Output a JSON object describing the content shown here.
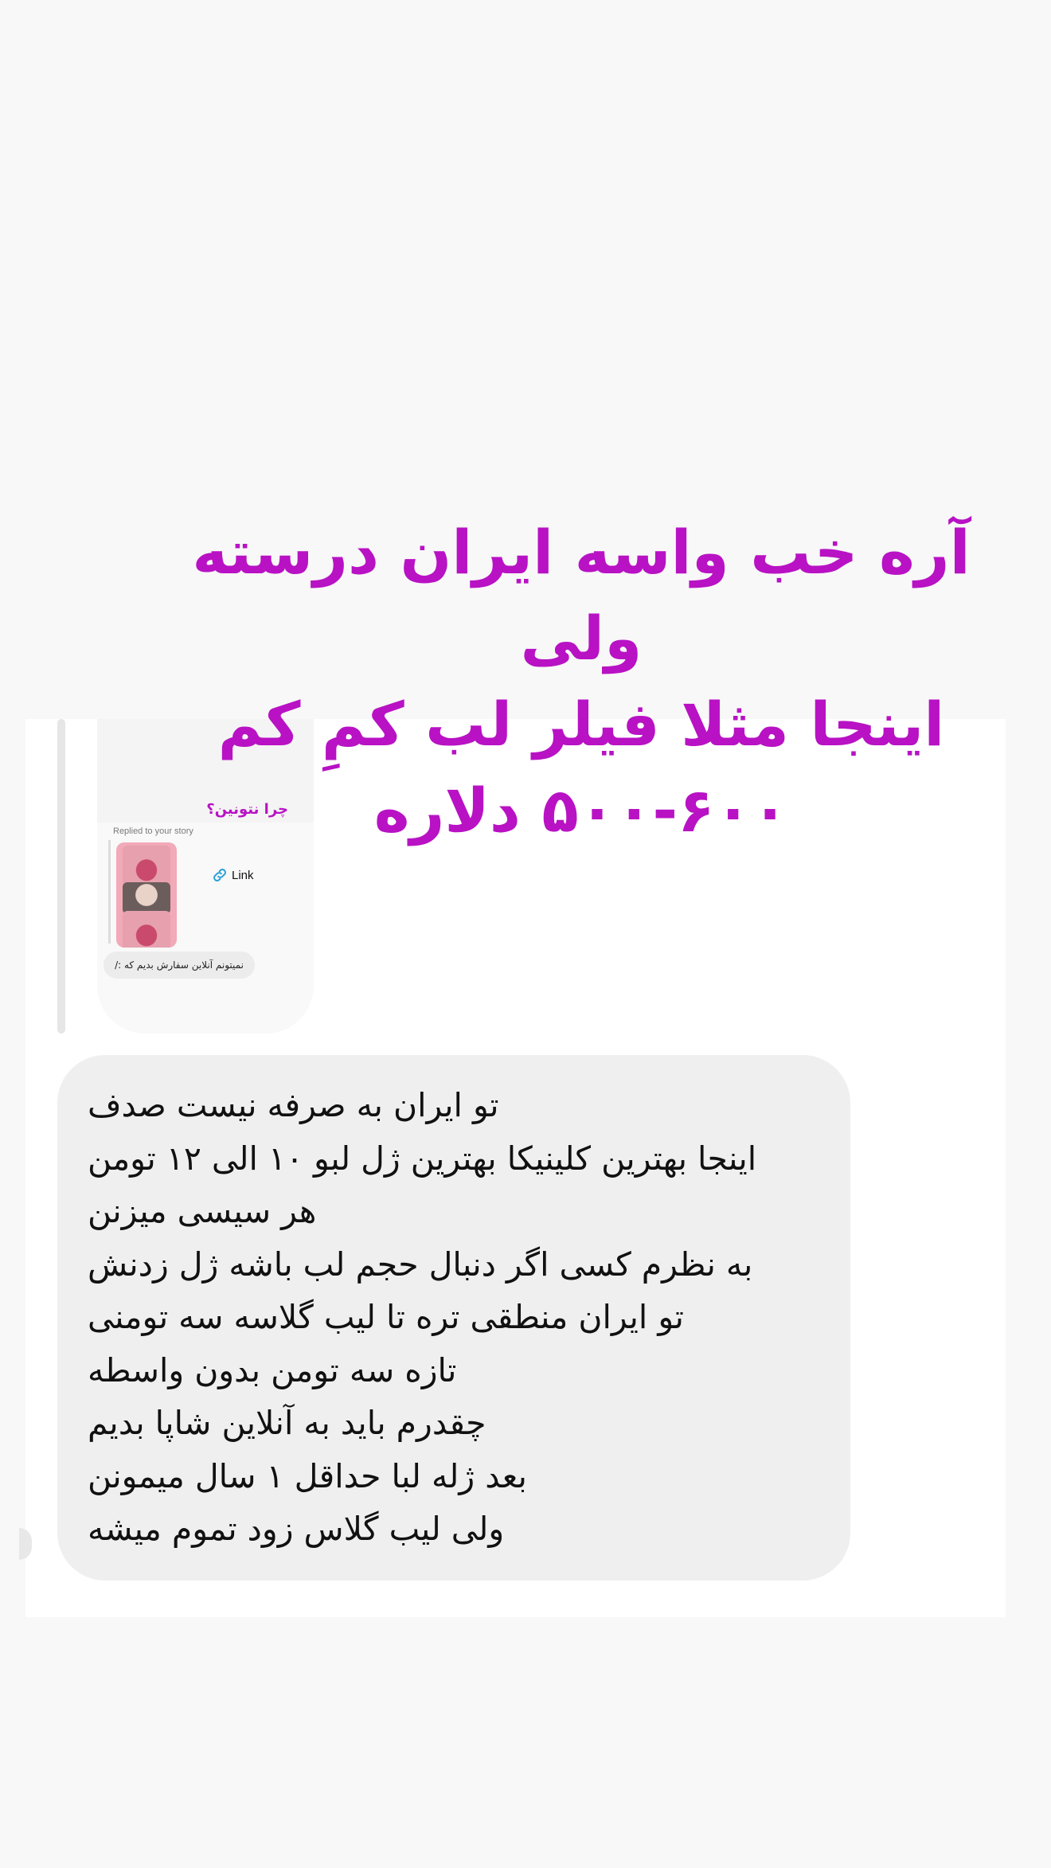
{
  "overlay_text": {
    "lines": [
      "آره خب واسه ایران درسته ولی",
      "اینجا مثلا فیلر لب کمِ کم",
      "۵۰۰-۶۰۰ دلاره"
    ]
  },
  "story_reply": {
    "story_caption": "چرا نتونین؟",
    "replied_label": "Replied to your story",
    "link_label": "Link",
    "reply_text": "نمیتونم آنلاین سفارش بدیم که :/"
  },
  "message": {
    "lines": [
      "تو ایران به صرفه نیست صدف",
      "اینجا بهترین کلینیکا بهترین ژل لبو ۱۰ الی ۱۲ تومن",
      "هر سیسی میزنن",
      "به نظرم کسی اگر دنبال حجم لب باشه ژل زدنش",
      "تو ایران منطقی تره تا لیب گلاسه سه تومنی",
      "تازه سه تومن بدون واسطه",
      "چقدرم باید به آنلاین شاپا بدیم",
      "بعد ژله لبا حداقل ۱ سال میمونن",
      "ولی لیب گلاس زود تموم میشه"
    ]
  },
  "colors": {
    "overlay_text": "#b812c4",
    "bubble_bg": "#efefef",
    "page_bg": "#f8f8f8",
    "link_icon": "#2a9fd6"
  },
  "icons": {
    "link": "link-icon"
  }
}
